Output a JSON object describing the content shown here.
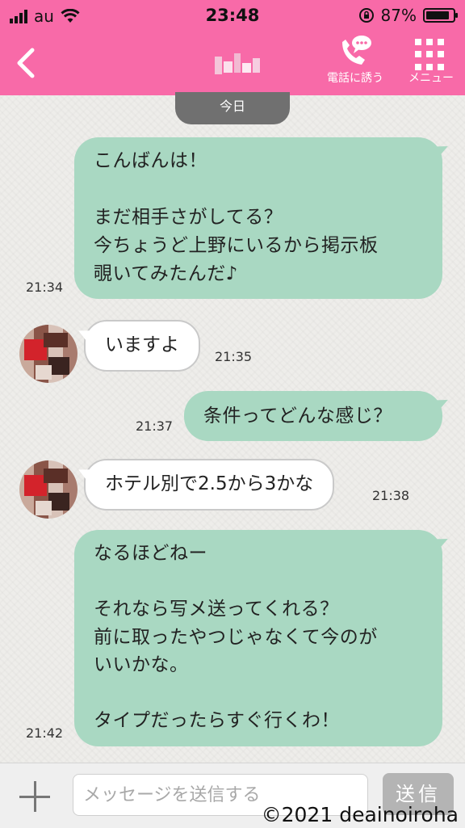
{
  "status_bar": {
    "carrier": "au",
    "time": "23:48",
    "battery": "87%",
    "battery_level": 0.87
  },
  "header": {
    "call_label": "電話に誘う",
    "menu_label": "メニュー",
    "icons": {
      "back": "chevron-left-icon",
      "call": "phone-chat-icon",
      "menu": "grid-icon"
    }
  },
  "date_divider": "今日",
  "messages": [
    {
      "side": "out",
      "text": "こんばんは！\n\nまだ相手さがしてる？\n今ちょうど上野にいるから掲示板\n覗いてみたんだ♪",
      "time": "21:34"
    },
    {
      "side": "in",
      "text": "いますよ",
      "time": "21:35"
    },
    {
      "side": "out",
      "text": "条件ってどんな感じ？",
      "time": "21:37"
    },
    {
      "side": "in",
      "text": "ホテル別で2.5から3かな",
      "time": "21:38"
    },
    {
      "side": "out",
      "text": "なるほどねー\n\nそれなら写メ送ってくれる？\n前に取ったやつじゃなくて今のが\nいいかな。\n\nタイプだったらすぐ行くわ！",
      "time": "21:42"
    }
  ],
  "composer": {
    "placeholder": "メッセージを送信する",
    "send_label": "送信"
  },
  "watermark": "©2021 deainoiroha",
  "colors": {
    "accent": "#f86aa8",
    "outgoing_bubble": "#a9d8c2",
    "date_pill": "#707070"
  }
}
